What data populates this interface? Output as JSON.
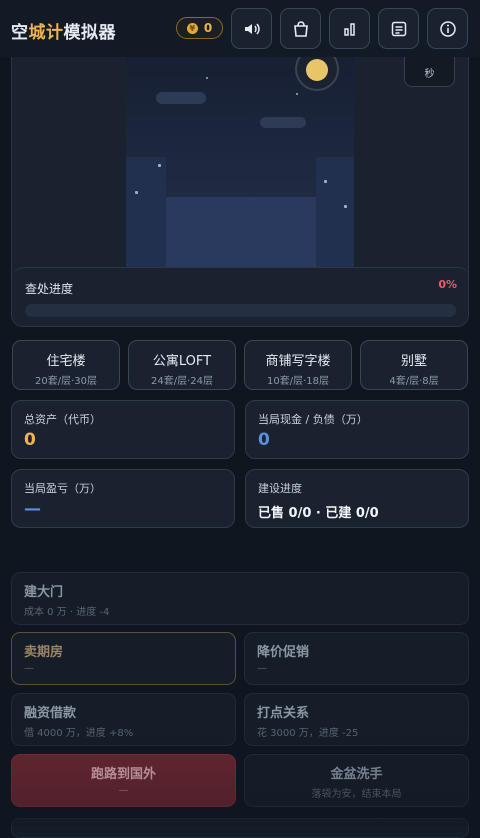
{
  "header": {
    "title_part1": "空",
    "title_accent": "城计",
    "title_part2": "模拟器",
    "coin_symbol": "¥",
    "coin_value": "0",
    "buttons": [
      "sound-icon",
      "shop-bag-icon",
      "stats-chart-icon",
      "log-list-icon",
      "info-icon"
    ]
  },
  "scene": {
    "timer_unit": "秒",
    "progress_label": "查处进度",
    "progress_percent": "0%",
    "progress_value": 0
  },
  "property_types": [
    {
      "name": "住宅楼",
      "detail": "20套/层·30层"
    },
    {
      "name": "公寓LOFT",
      "detail": "24套/层·24层"
    },
    {
      "name": "商铺写字楼",
      "detail": "10套/层·18层"
    },
    {
      "name": "别墅",
      "detail": "4套/层·8层"
    }
  ],
  "stats": {
    "total_assets": {
      "label": "总资产（代币）",
      "value": "0"
    },
    "cash_debt": {
      "label": "当局现金 / 负债（万）",
      "value": "0"
    },
    "profit": {
      "label": "当局盈亏（万）",
      "value": "—"
    },
    "build_progress": {
      "label": "建设进度",
      "value": "已售 0/0 · 已建 0/0"
    }
  },
  "actions": {
    "gate": {
      "title": "建大门",
      "sub": "成本 0 万 · 进度 -4"
    },
    "presale": {
      "title": "卖期房",
      "sub": "—"
    },
    "discount": {
      "title": "降价促销",
      "sub": "—"
    },
    "financing": {
      "title": "融资借款",
      "sub": "借 4000 万，进度 +8%"
    },
    "connections": {
      "title": "打点关系",
      "sub": "花 3000 万，进度 -25"
    },
    "flee": {
      "title": "跑路到国外",
      "sub": "—"
    },
    "quit": {
      "title": "金盆洗手",
      "sub": "落袋为安，结束本局"
    }
  },
  "colors": {
    "accent_gold": "#f0b54a",
    "danger_red": "#ef5b67",
    "value_blue": "#5b8fe0",
    "flee_button_bg": "#6a2630"
  }
}
